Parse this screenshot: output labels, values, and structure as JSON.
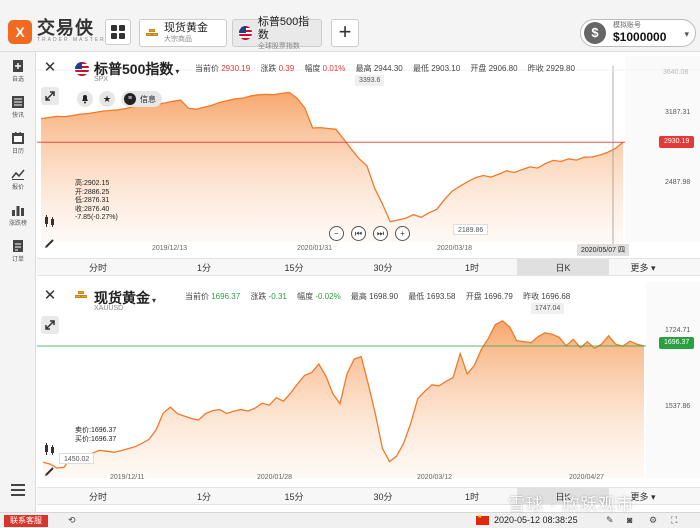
{
  "app": {
    "logo_glyph": "X",
    "name": "交易侠",
    "subtitle": "TRADER MASTER"
  },
  "tabs": [
    {
      "name": "现货黄金",
      "sub": "大宗商品"
    },
    {
      "name": "标普500指数",
      "sub": "全球股票指数"
    }
  ],
  "account": {
    "label": "模拟账号",
    "balance": "$1000000",
    "icon": "dollar-icon"
  },
  "nav": [
    {
      "label": "自选",
      "icon": "star-add-icon"
    },
    {
      "label": "快讯",
      "icon": "news-icon"
    },
    {
      "label": "日历",
      "icon": "calendar-icon"
    },
    {
      "label": "报价",
      "icon": "quote-line-icon"
    },
    {
      "label": "涨跌榜",
      "icon": "bar-rank-icon"
    },
    {
      "label": "订单",
      "icon": "order-icon"
    }
  ],
  "panel1": {
    "title": "标普500指数",
    "code": "SPX",
    "quotes": {
      "current_label": "当前价",
      "current": "2930.19",
      "change_label": "涨跌",
      "change": "0.39",
      "pct_label": "幅度",
      "pct": "0.01%",
      "high_label": "最高",
      "high": "2944.30",
      "low_label": "最低",
      "low": "2903.10",
      "open_label": "开盘",
      "open": "2906.80",
      "prev_label": "昨收",
      "prev": "2929.80"
    },
    "info_label": "信息",
    "ohlc": [
      "高:2902.15",
      "开:2886.25",
      "低:2876.31",
      "收:2876.40",
      "-7.85(-0.27%)"
    ],
    "high_label": "3393.6",
    "low_label": "2189.86",
    "y_labels": [
      "3187.31",
      "2487.98"
    ],
    "y_top_faint": "3640.08",
    "price_tag": "2930.19",
    "cursor_date": "2020/05/07 四",
    "x_labels": [
      "2019/12/13",
      "2020/01/31",
      "2020/03/18"
    ],
    "replay": [
      "−",
      "⏮",
      "⏭",
      "+"
    ],
    "accent": "#e53935"
  },
  "panel2": {
    "title": "现货黄金",
    "code": "XAUUSD",
    "quotes": {
      "current_label": "当前价",
      "current": "1696.37",
      "change_label": "涨跌",
      "change": "-0.31",
      "pct_label": "幅度",
      "pct": "-0.02%",
      "high_label": "最高",
      "high": "1698.90",
      "low_label": "最低",
      "low": "1693.58",
      "open_label": "开盘",
      "open": "1696.79",
      "prev_label": "昨收",
      "prev": "1696.68"
    },
    "ohlc": [
      "卖价:1696.37",
      "买价:1696.37"
    ],
    "high_label": "1747.04",
    "low_label": "1450.02",
    "y_labels": [
      "1724.71",
      "1537.86"
    ],
    "price_tag": "1696.37",
    "x_labels": [
      "2019/12/11",
      "2020/01/28",
      "2020/03/12",
      "2020/04/27"
    ],
    "accent": "#2aa040"
  },
  "timeframes": [
    "分时",
    "1分",
    "15分",
    "30分",
    "1时",
    "日K",
    "更多"
  ],
  "active_timeframe": "日K",
  "statusbar": {
    "contact": "联系客服",
    "datetime": "2020-05-12 08:38:25"
  },
  "watermark": "雪球 · 欣跃观市",
  "chart_data": [
    {
      "type": "area",
      "title": "标普500指数",
      "x_labels": [
        "2019/12/13",
        "2020/01/31",
        "2020/03/18"
      ],
      "values": [
        3150,
        3160,
        3170,
        3168,
        3178,
        3190,
        3196,
        3208,
        3220,
        3226,
        3232,
        3245,
        3262,
        3278,
        3274,
        3283,
        3296,
        3311,
        3322,
        3246,
        3237,
        3255,
        3273,
        3300,
        3318,
        3333,
        3340,
        3360,
        3372,
        3375,
        3373,
        3385,
        3393.6,
        3340,
        3250,
        3062,
        3066,
        3058,
        3050,
        2960,
        2865,
        2775,
        2710,
        2500,
        2355,
        2189.86,
        2205,
        2222,
        2255,
        2230,
        2272,
        2305,
        2395,
        2475,
        2520,
        2562,
        2600,
        2620,
        2605,
        2633,
        2663,
        2648,
        2675,
        2700,
        2689,
        2731,
        2760,
        2750,
        2775,
        2763,
        2790,
        2792,
        2810,
        2835,
        2870,
        2930.19
      ],
      "ylim": [
        2000,
        3640
      ],
      "high": 3393.6,
      "low": 2189.86,
      "last": 2930.19
    },
    {
      "type": "area",
      "title": "现货黄金",
      "x_labels": [
        "2019/12/11",
        "2020/01/28",
        "2020/03/12",
        "2020/04/27"
      ],
      "values": [
        1462,
        1458,
        1450.02,
        1452,
        1474,
        1479,
        1474,
        1480,
        1486,
        1484,
        1482,
        1485,
        1489,
        1493,
        1500,
        1508,
        1527,
        1561,
        1573,
        1560,
        1555,
        1550,
        1547,
        1560,
        1566,
        1568,
        1560,
        1565,
        1568,
        1565,
        1571,
        1581,
        1577,
        1592,
        1585,
        1601,
        1620,
        1637,
        1643,
        1660,
        1636,
        1600,
        1580,
        1640,
        1670,
        1675,
        1620,
        1560,
        1490,
        1463,
        1474,
        1500,
        1540,
        1590,
        1605,
        1618,
        1616,
        1625,
        1633,
        1681,
        1640,
        1657,
        1690,
        1712,
        1740,
        1747.04,
        1735,
        1707,
        1705,
        1703,
        1715,
        1723,
        1720,
        1714,
        1697,
        1710,
        1693,
        1705,
        1692,
        1700,
        1717,
        1700,
        1696,
        1706,
        1700,
        1696.37
      ],
      "ylim": [
        1430,
        1765
      ],
      "high": 1747.04,
      "low": 1450.02,
      "last": 1696.37
    }
  ]
}
